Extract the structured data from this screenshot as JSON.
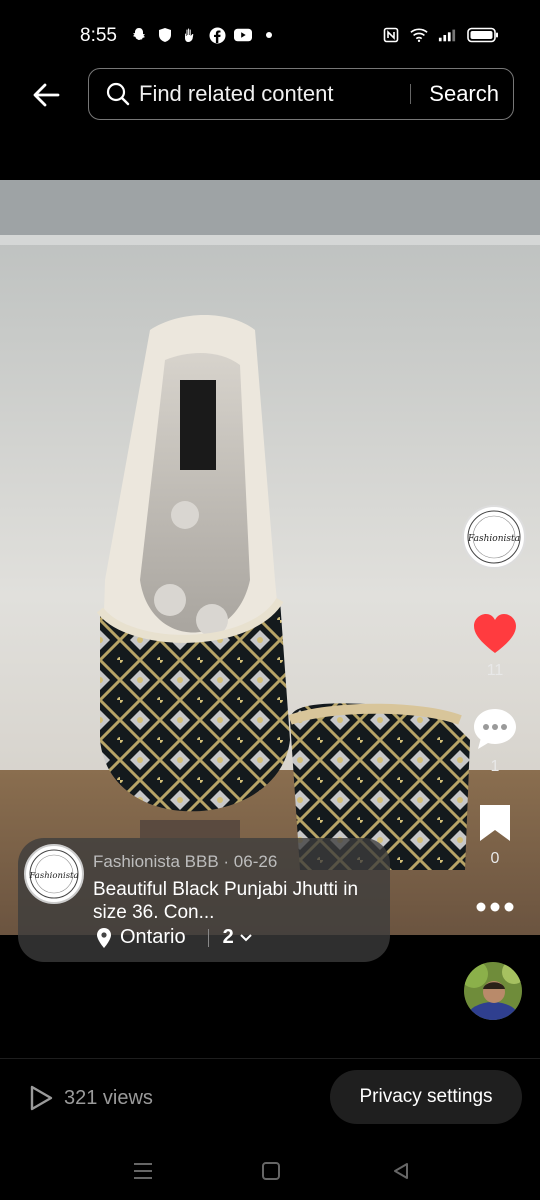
{
  "status_bar": {
    "time": "8:55",
    "left_icons": [
      "snapchat-icon",
      "shield-icon",
      "hand-icon",
      "facebook-icon",
      "youtube-icon",
      "dot-icon"
    ],
    "right_icons": [
      "nfc-icon",
      "wifi-icon",
      "signal-icon",
      "battery-icon"
    ]
  },
  "header": {
    "search_placeholder": "Find related content",
    "search_button": "Search"
  },
  "post": {
    "author": "Fashionista BBB",
    "date": "06-26",
    "meta_separator": " · ",
    "caption": "Beautiful Black Punjabi Jhutti in size 36. Con...",
    "location": "Ontario",
    "photo_count": "2",
    "avatar_logo_text": "Fashionista"
  },
  "actions": {
    "likes": "11",
    "comments": "1",
    "saves": "0",
    "like_color": "#ff3b3f"
  },
  "footer": {
    "views": "321 views",
    "privacy_button": "Privacy settings"
  }
}
